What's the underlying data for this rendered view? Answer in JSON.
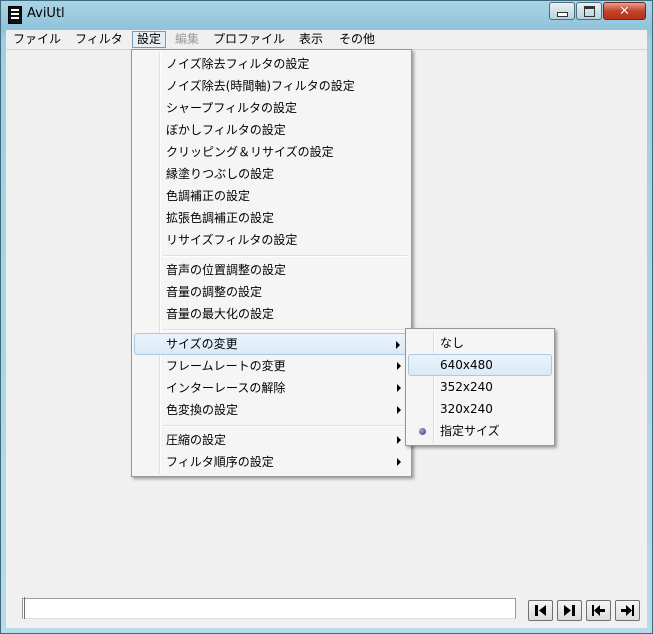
{
  "window": {
    "title": "AviUtl"
  },
  "menubar": [
    {
      "label": "ファイル",
      "state": "normal"
    },
    {
      "label": "フィルタ",
      "state": "normal"
    },
    {
      "label": "設定",
      "state": "open"
    },
    {
      "label": "編集",
      "state": "disabled"
    },
    {
      "label": "プロファイル",
      "state": "normal"
    },
    {
      "label": "表示",
      "state": "normal"
    },
    {
      "label": "その他",
      "state": "normal"
    }
  ],
  "settings_menu": {
    "groups": [
      {
        "items": [
          {
            "label": "ノイズ除去フィルタの設定"
          },
          {
            "label": "ノイズ除去(時間軸)フィルタの設定"
          },
          {
            "label": "シャープフィルタの設定"
          },
          {
            "label": "ぼかしフィルタの設定"
          },
          {
            "label": "クリッピング＆リサイズの設定"
          },
          {
            "label": "縁塗りつぶしの設定"
          },
          {
            "label": "色調補正の設定"
          },
          {
            "label": "拡張色調補正の設定"
          },
          {
            "label": "リサイズフィルタの設定"
          }
        ]
      },
      {
        "items": [
          {
            "label": "音声の位置調整の設定"
          },
          {
            "label": "音量の調整の設定"
          },
          {
            "label": "音量の最大化の設定"
          }
        ]
      },
      {
        "items": [
          {
            "label": "サイズの変更",
            "submenu": true,
            "highlighted": true
          },
          {
            "label": "フレームレートの変更",
            "submenu": true
          },
          {
            "label": "インターレースの解除",
            "submenu": true
          },
          {
            "label": "色変換の設定",
            "submenu": true
          }
        ]
      },
      {
        "items": [
          {
            "label": "圧縮の設定",
            "submenu": true
          },
          {
            "label": "フィルタ順序の設定",
            "submenu": true
          }
        ]
      }
    ]
  },
  "size_submenu": {
    "items": [
      {
        "label": "なし"
      },
      {
        "label": "640x480",
        "highlighted": true
      },
      {
        "label": "352x240"
      },
      {
        "label": "320x240"
      },
      {
        "label": "指定サイズ",
        "checked": true
      }
    ]
  },
  "nav_buttons": [
    {
      "name": "prev-frame-button",
      "icon": "step-back-icon"
    },
    {
      "name": "next-frame-button",
      "icon": "step-forward-icon"
    },
    {
      "name": "first-frame-button",
      "icon": "skip-start-icon"
    },
    {
      "name": "last-frame-button",
      "icon": "skip-end-icon"
    }
  ]
}
